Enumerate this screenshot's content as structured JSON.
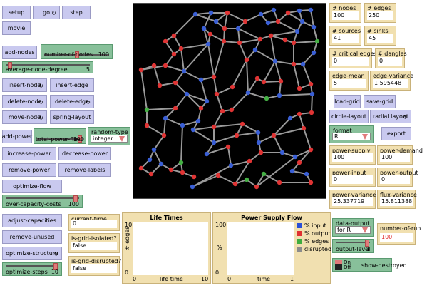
{
  "buttons": {
    "setup": "setup",
    "go": "go",
    "step": "step",
    "movie": "movie",
    "add_nodes": "add-nodes",
    "insert_node": "insert-node",
    "insert_edge": "insert-edge",
    "delete_node": "delete-node",
    "delete_edge": "delete-edge",
    "move_node": "move-node",
    "spring_layout": "spring-layout",
    "add_power": "add-power",
    "increase_power": "increase-power",
    "decrease_power": "decrease-power",
    "remove_power": "remove-power",
    "remove_labels": "remove-labels",
    "optimize_flow": "optimize-flow",
    "adjust_capacities": "adjust-capacities",
    "remove_unused": "remove-unused",
    "optimize_structure": "optimize-structure",
    "load_grid": "load-grid",
    "save_grid": "save-grid",
    "circle_layout": "circle-layout",
    "radial_layout": "radial layout",
    "export": "export"
  },
  "forever_glyph": "↻",
  "sliders": {
    "number_of_nodes": {
      "label": "number-of-nodes",
      "value": "100",
      "fraction": 0.5
    },
    "average_node_degree": {
      "label": "average-node-degree",
      "value": "5",
      "fraction": 0.03
    },
    "total_power_flux": {
      "label": "total-power-flux",
      "value": "100",
      "fraction": 0.98
    },
    "over_capacity_costs": {
      "label": "over-capacity-costs",
      "value": "100",
      "fraction": 0.98
    },
    "optimize_steps": {
      "label": "optimize-steps",
      "value": "10",
      "fraction": 0.98
    },
    "output_level": {
      "label": "output-level",
      "value": "1",
      "fraction": 0.98
    }
  },
  "choosers": {
    "random_type": {
      "label": "random-type",
      "value": "integer"
    },
    "format": {
      "label": "format",
      "value": "R"
    },
    "data_output": {
      "label": "data-output",
      "value": "for R"
    }
  },
  "monitors": {
    "nodes": {
      "label": "# nodes",
      "value": "100"
    },
    "edges": {
      "label": "# edges",
      "value": "250"
    },
    "sources": {
      "label": "# sources",
      "value": "41"
    },
    "sinks": {
      "label": "# sinks",
      "value": "45"
    },
    "critical_edges": {
      "label": "# critical edges",
      "value": "0"
    },
    "dangles": {
      "label": "# dangles",
      "value": "0"
    },
    "edge_mean": {
      "label": "edge-mean",
      "value": "5"
    },
    "edge_variance": {
      "label": "edge-variance",
      "value": "1.595448"
    },
    "power_supply": {
      "label": "power-supply",
      "value": "100"
    },
    "power_demand": {
      "label": "power-demand",
      "value": "100"
    },
    "power_input": {
      "label": "power-input",
      "value": "0"
    },
    "power_output": {
      "label": "power-output",
      "value": "0"
    },
    "power_variance": {
      "label": "power-variance",
      "value": "25.337719"
    },
    "flux_variance": {
      "label": "flux-variance",
      "value": "15.811388"
    },
    "current_time": {
      "label": "current-time",
      "value": "0"
    },
    "is_grid_isolated": {
      "label": "is-grid-isolated?",
      "value": "false"
    },
    "is_grid_disrupted": {
      "label": "is-grid-disrupted?",
      "value": "false"
    },
    "number_of_run": {
      "label": "number-of-run",
      "value": "100"
    }
  },
  "plots": {
    "life_times": {
      "title": "Life Times",
      "ylabel": "# edges",
      "xlabel": "life time",
      "ymax": "10",
      "ymin": "0",
      "xmin": "0",
      "xmax": "10"
    },
    "power_supply_flow": {
      "title": "Power Supply Flow",
      "ylabel": "%",
      "xlabel": "time",
      "ymax": "100",
      "ymin": "0",
      "xmin": "0",
      "xmax": "1"
    }
  },
  "legend": [
    {
      "label": "% input",
      "color": "#2a4fd6"
    },
    {
      "label": "% output",
      "color": "#e03030"
    },
    {
      "label": "% edges",
      "color": "#3fae3f"
    },
    {
      "label": "disrupted?",
      "color": "#8c8c8c"
    }
  ],
  "toggle": {
    "on": "On",
    "off": "Off",
    "label": "show-destroyed"
  },
  "colors": {
    "button": "#c9c9ef",
    "slider": "#88c09a",
    "monitor": "#f1e0b0",
    "world": "#000000",
    "edge": "#9a9a9a",
    "node_blue": "#3a5fd6",
    "node_red": "#e03434",
    "node_green": "#45b045"
  },
  "network": {
    "nodes": [
      [
        274,
        20,
        "b"
      ],
      [
        296,
        18,
        "b"
      ],
      [
        319,
        18,
        "r"
      ],
      [
        303,
        30,
        "b"
      ],
      [
        286,
        40,
        "b"
      ],
      [
        295,
        48,
        "r"
      ],
      [
        315,
        40,
        "r"
      ],
      [
        334,
        40,
        "b"
      ],
      [
        344,
        30,
        "r"
      ],
      [
        336,
        60,
        "r"
      ],
      [
        314,
        58,
        "r"
      ],
      [
        292,
        62,
        "b"
      ],
      [
        244,
        50,
        "r"
      ],
      [
        232,
        58,
        "r"
      ],
      [
        254,
        68,
        "r"
      ],
      [
        244,
        76,
        "r"
      ],
      [
        232,
        92,
        "r"
      ],
      [
        258,
        100,
        "b"
      ],
      [
        366,
        20,
        "b"
      ],
      [
        376,
        32,
        "b"
      ],
      [
        384,
        14,
        "b"
      ],
      [
        390,
        30,
        "r"
      ],
      [
        404,
        18,
        "r"
      ],
      [
        420,
        15,
        "b"
      ],
      [
        424,
        30,
        "b"
      ],
      [
        417,
        44,
        "b"
      ],
      [
        380,
        50,
        "r"
      ],
      [
        365,
        55,
        "r"
      ],
      [
        400,
        56,
        "r"
      ],
      [
        412,
        60,
        "r"
      ],
      [
        436,
        14,
        "b"
      ],
      [
        440,
        38,
        "b"
      ],
      [
        445,
        58,
        "g"
      ],
      [
        440,
        74,
        "b"
      ],
      [
        358,
        70,
        "b"
      ],
      [
        346,
        84,
        "r"
      ],
      [
        386,
        86,
        "b"
      ],
      [
        412,
        90,
        "r"
      ],
      [
        425,
        90,
        "b"
      ],
      [
        198,
        98,
        "r"
      ],
      [
        216,
        92,
        "r"
      ],
      [
        246,
        116,
        "r"
      ],
      [
        224,
        120,
        "r"
      ],
      [
        262,
        132,
        "b"
      ],
      [
        282,
        112,
        "b"
      ],
      [
        300,
        108,
        "r"
      ],
      [
        326,
        122,
        "r"
      ],
      [
        304,
        132,
        "r"
      ],
      [
        290,
        142,
        "b"
      ],
      [
        282,
        152,
        "r"
      ],
      [
        348,
        130,
        "b"
      ],
      [
        361,
        110,
        "r"
      ],
      [
        370,
        115,
        "r"
      ],
      [
        374,
        138,
        "g"
      ],
      [
        394,
        114,
        "r"
      ],
      [
        392,
        134,
        "b"
      ],
      [
        420,
        124,
        "r"
      ],
      [
        436,
        118,
        "r"
      ],
      [
        438,
        132,
        "b"
      ],
      [
        246,
        152,
        "r"
      ],
      [
        232,
        166,
        "b"
      ],
      [
        256,
        176,
        "b"
      ],
      [
        278,
        170,
        "b"
      ],
      [
        271,
        182,
        "b"
      ],
      [
        300,
        178,
        "r"
      ],
      [
        312,
        156,
        "r"
      ],
      [
        325,
        154,
        "r"
      ],
      [
        340,
        174,
        "r"
      ],
      [
        332,
        190,
        "r"
      ],
      [
        362,
        186,
        "b"
      ],
      [
        363,
        200,
        "b"
      ],
      [
        384,
        190,
        "r"
      ],
      [
        407,
        166,
        "b"
      ],
      [
        420,
        160,
        "r"
      ],
      [
        437,
        158,
        "r"
      ],
      [
        426,
        180,
        "r"
      ],
      [
        206,
        154,
        "g"
      ],
      [
        206,
        176,
        "r"
      ],
      [
        230,
        190,
        "r"
      ],
      [
        216,
        210,
        "b"
      ],
      [
        210,
        224,
        "b"
      ],
      [
        198,
        236,
        "r"
      ],
      [
        212,
        244,
        "r"
      ],
      [
        226,
        230,
        "b"
      ],
      [
        240,
        238,
        "r"
      ],
      [
        254,
        228,
        "g"
      ],
      [
        256,
        242,
        "r"
      ],
      [
        272,
        248,
        "r"
      ],
      [
        300,
        200,
        "b"
      ],
      [
        290,
        216,
        "b"
      ],
      [
        320,
        206,
        "r"
      ],
      [
        324,
        232,
        "b"
      ],
      [
        350,
        226,
        "r"
      ],
      [
        366,
        214,
        "r"
      ],
      [
        396,
        214,
        "b"
      ],
      [
        414,
        220,
        "b"
      ],
      [
        436,
        210,
        "r"
      ],
      [
        420,
        228,
        "r"
      ],
      [
        410,
        240,
        "b"
      ],
      [
        430,
        244,
        "b"
      ],
      [
        436,
        256,
        "r"
      ],
      [
        392,
        256,
        "r"
      ],
      [
        370,
        244,
        "g"
      ],
      [
        360,
        262,
        "r"
      ],
      [
        346,
        252,
        "g"
      ],
      [
        330,
        258,
        "r"
      ],
      [
        306,
        246,
        "r"
      ],
      [
        270,
        262,
        "b"
      ]
    ],
    "edges": [
      [
        0,
        1
      ],
      [
        1,
        2
      ],
      [
        0,
        3
      ],
      [
        3,
        2
      ],
      [
        1,
        4
      ],
      [
        4,
        5
      ],
      [
        3,
        6
      ],
      [
        2,
        6
      ],
      [
        6,
        7
      ],
      [
        2,
        8
      ],
      [
        8,
        7
      ],
      [
        7,
        9
      ],
      [
        6,
        10
      ],
      [
        5,
        10
      ],
      [
        5,
        11
      ],
      [
        4,
        11
      ],
      [
        10,
        9
      ],
      [
        0,
        12
      ],
      [
        12,
        13
      ],
      [
        13,
        15
      ],
      [
        12,
        14
      ],
      [
        14,
        15
      ],
      [
        15,
        16
      ],
      [
        16,
        17
      ],
      [
        14,
        17
      ],
      [
        11,
        14
      ],
      [
        11,
        17
      ],
      [
        8,
        18
      ],
      [
        18,
        19
      ],
      [
        18,
        20
      ],
      [
        20,
        21
      ],
      [
        19,
        21
      ],
      [
        21,
        22
      ],
      [
        22,
        23
      ],
      [
        23,
        24
      ],
      [
        22,
        24
      ],
      [
        24,
        25
      ],
      [
        21,
        25
      ],
      [
        25,
        26
      ],
      [
        26,
        27
      ],
      [
        9,
        27
      ],
      [
        7,
        27
      ],
      [
        26,
        28
      ],
      [
        28,
        29
      ],
      [
        25,
        29
      ],
      [
        23,
        30
      ],
      [
        30,
        31
      ],
      [
        24,
        31
      ],
      [
        31,
        32
      ],
      [
        29,
        32
      ],
      [
        32,
        33
      ],
      [
        27,
        34
      ],
      [
        34,
        35
      ],
      [
        9,
        35
      ],
      [
        34,
        36
      ],
      [
        26,
        36
      ],
      [
        36,
        37
      ],
      [
        29,
        37
      ],
      [
        37,
        38
      ],
      [
        33,
        38
      ],
      [
        16,
        39
      ],
      [
        39,
        40
      ],
      [
        40,
        42
      ],
      [
        42,
        41
      ],
      [
        41,
        17
      ],
      [
        17,
        44
      ],
      [
        44,
        45
      ],
      [
        45,
        47
      ],
      [
        47,
        46
      ],
      [
        46,
        35
      ],
      [
        44,
        48
      ],
      [
        48,
        49
      ],
      [
        43,
        48
      ],
      [
        41,
        43
      ],
      [
        43,
        49
      ],
      [
        11,
        45
      ],
      [
        10,
        45
      ],
      [
        35,
        50
      ],
      [
        50,
        51
      ],
      [
        51,
        52
      ],
      [
        52,
        54
      ],
      [
        54,
        55
      ],
      [
        55,
        53
      ],
      [
        53,
        50
      ],
      [
        36,
        54
      ],
      [
        36,
        52
      ],
      [
        37,
        56
      ],
      [
        56,
        57
      ],
      [
        57,
        58
      ],
      [
        58,
        55
      ],
      [
        38,
        57
      ],
      [
        43,
        59
      ],
      [
        59,
        60
      ],
      [
        60,
        61
      ],
      [
        61,
        62
      ],
      [
        62,
        49
      ],
      [
        62,
        63
      ],
      [
        63,
        64
      ],
      [
        64,
        65
      ],
      [
        65,
        66
      ],
      [
        66,
        50
      ],
      [
        47,
        65
      ],
      [
        64,
        67
      ],
      [
        67,
        68
      ],
      [
        68,
        69
      ],
      [
        69,
        70
      ],
      [
        70,
        71
      ],
      [
        71,
        72
      ],
      [
        72,
        73
      ],
      [
        73,
        74
      ],
      [
        74,
        58
      ],
      [
        73,
        75
      ],
      [
        75,
        71
      ],
      [
        67,
        69
      ],
      [
        39,
        76
      ],
      [
        76,
        59
      ],
      [
        76,
        77
      ],
      [
        77,
        78
      ],
      [
        78,
        60
      ],
      [
        78,
        79
      ],
      [
        79,
        80
      ],
      [
        80,
        81
      ],
      [
        81,
        82
      ],
      [
        82,
        83
      ],
      [
        79,
        83
      ],
      [
        83,
        84
      ],
      [
        84,
        85
      ],
      [
        85,
        86
      ],
      [
        86,
        87
      ],
      [
        84,
        86
      ],
      [
        85,
        61
      ],
      [
        87,
        118
      ],
      [
        118,
        112
      ],
      [
        112,
        90
      ],
      [
        90,
        89
      ],
      [
        89,
        88
      ],
      [
        88,
        64
      ],
      [
        88,
        68
      ],
      [
        90,
        91
      ],
      [
        91,
        92
      ],
      [
        92,
        93
      ],
      [
        93,
        94
      ],
      [
        94,
        95
      ],
      [
        95,
        96
      ],
      [
        96,
        97
      ],
      [
        97,
        98
      ],
      [
        98,
        99
      ],
      [
        99,
        100
      ],
      [
        100,
        101
      ],
      [
        101,
        102
      ],
      [
        102,
        103
      ],
      [
        103,
        104
      ],
      [
        104,
        105
      ],
      [
        105,
        106
      ],
      [
        106,
        107
      ],
      [
        107,
        91
      ],
      [
        93,
        70
      ],
      [
        94,
        71
      ],
      [
        96,
        75
      ],
      [
        92,
        105
      ],
      [
        103,
        95
      ],
      [
        108,
        89
      ],
      [
        108,
        118
      ],
      [
        63,
        88
      ]
    ]
  }
}
